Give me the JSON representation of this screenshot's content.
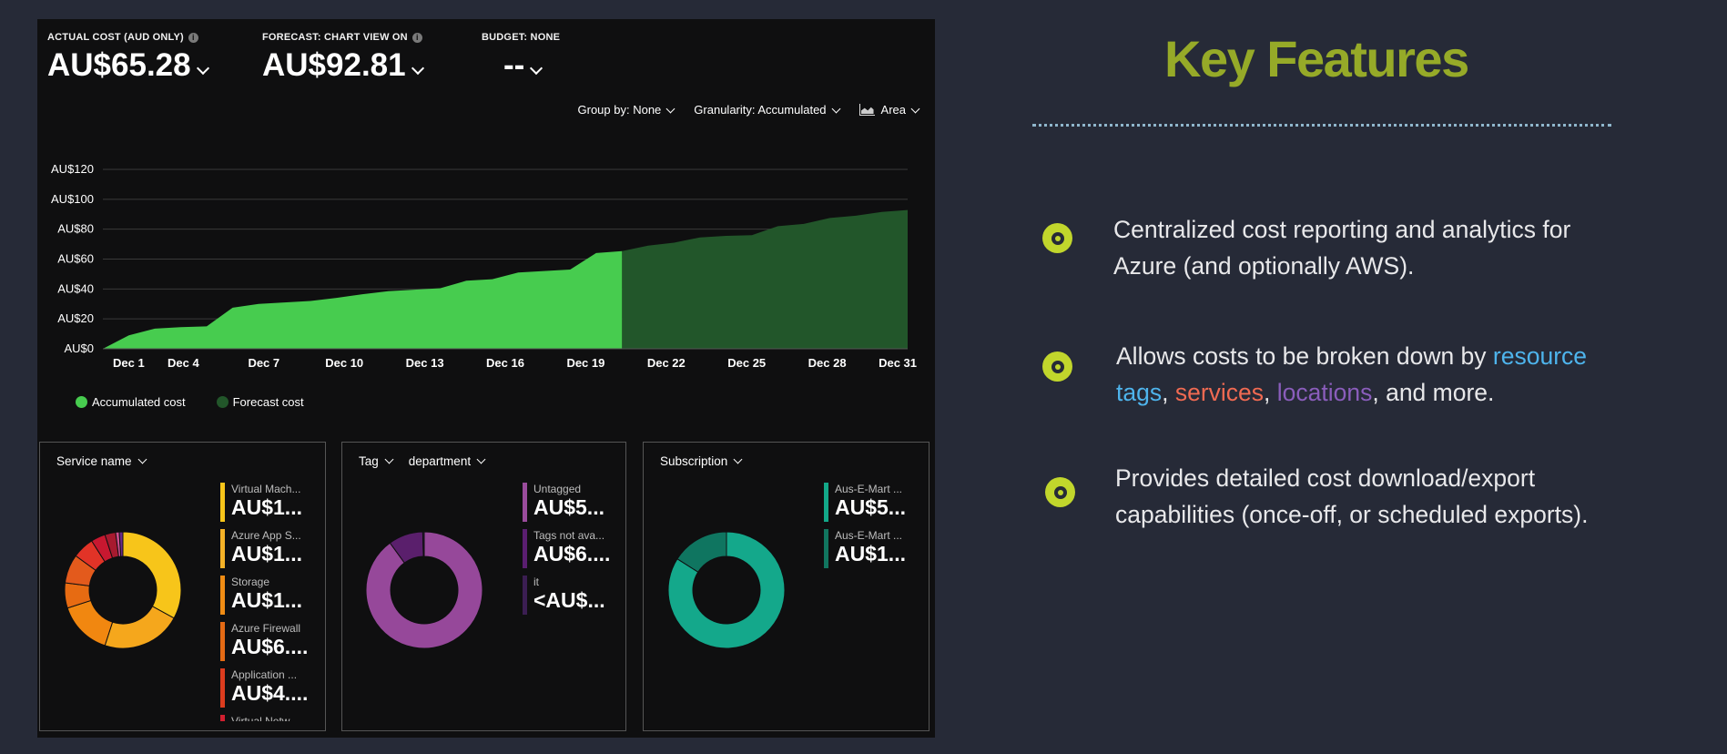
{
  "summary": {
    "actual": {
      "label": "ACTUAL COST (AUD ONLY)",
      "value": "AU$65.28"
    },
    "forecast": {
      "label": "FORECAST: CHART VIEW ON",
      "value": "AU$92.81"
    },
    "budget": {
      "label": "BUDGET: NONE",
      "value": "--"
    }
  },
  "controls": {
    "group_by": "Group by: None",
    "granularity": "Granularity: Accumulated",
    "view": "Area"
  },
  "chart_data": {
    "type": "area",
    "x_tick_labels": [
      "Dec 1",
      "Dec 4",
      "Dec 7",
      "Dec 10",
      "Dec 13",
      "Dec 16",
      "Dec 19",
      "Dec 22",
      "Dec 25",
      "Dec 28",
      "Dec 31"
    ],
    "y_tick_labels": [
      "AU$0",
      "AU$20",
      "AU$40",
      "AU$60",
      "AU$80",
      "AU$100",
      "AU$120"
    ],
    "ylim": [
      0,
      120
    ],
    "xlim": [
      0,
      31
    ],
    "grid": true,
    "legend_position": "bottom-left",
    "series": [
      {
        "name": "Accumulated cost",
        "color": "#47cc4f",
        "x": [
          0,
          1,
          2,
          3,
          4,
          5,
          6,
          7,
          8,
          9,
          10,
          11,
          12,
          13,
          14,
          15,
          16,
          17,
          18,
          19,
          20
        ],
        "values": [
          0,
          9,
          13.5,
          14.5,
          15,
          27.5,
          30,
          31,
          32,
          34,
          36.5,
          38.5,
          39.5,
          40.5,
          45.5,
          46.5,
          51,
          52,
          53,
          64,
          65.3
        ]
      },
      {
        "name": "Forecast cost",
        "color": "#22562a",
        "x": [
          20,
          21,
          22,
          23,
          24,
          25,
          26,
          27,
          28,
          29,
          30,
          31
        ],
        "values": [
          65.3,
          69,
          71,
          74.5,
          75.5,
          76,
          82,
          83.5,
          87.5,
          89,
          91.5,
          92.8
        ]
      }
    ]
  },
  "cards": [
    {
      "header": "Service name",
      "header2": "",
      "items": [
        {
          "name": "Virtual Mach...",
          "value": "AU$1...",
          "color": "#f7c51a"
        },
        {
          "name": "Azure App S...",
          "value": "AU$1...",
          "color": "#f5b227"
        },
        {
          "name": "Storage",
          "value": "AU$1...",
          "color": "#f08c14"
        },
        {
          "name": "Azure Firewall",
          "value": "AU$6....",
          "color": "#e46a14"
        },
        {
          "name": "Application ...",
          "value": "AU$4....",
          "color": "#dc3c1e"
        },
        {
          "name": "Virtual Netw...",
          "value": "",
          "color": "#d11f2f"
        }
      ],
      "donut": {
        "values": [
          33,
          22,
          15,
          7,
          8,
          6,
          4,
          3,
          1,
          1
        ],
        "colors": [
          "#f7c51a",
          "#f5a71c",
          "#f18710",
          "#e76b12",
          "#e35a1c",
          "#e23327",
          "#c81830",
          "#a71a2f",
          "#d04f8f",
          "#6b2a8a"
        ]
      }
    },
    {
      "header": "Tag",
      "header2": "department",
      "items": [
        {
          "name": "Untagged",
          "value": "AU$5...",
          "color": "#9a4c9c"
        },
        {
          "name": "Tags not ava...",
          "value": "AU$6....",
          "color": "#5a1e70"
        },
        {
          "name": "it",
          "value": "<AU$...",
          "color": "#3b1e52"
        }
      ],
      "donut": {
        "values": [
          90,
          9.6,
          0.4
        ],
        "colors": [
          "#96489a",
          "#5a1f6c",
          "#2f1a44"
        ]
      }
    },
    {
      "header": "Subscription",
      "header2": "",
      "items": [
        {
          "name": "Aus-E-Mart ...",
          "value": "AU$5...",
          "color": "#13a889"
        },
        {
          "name": "Aus-E-Mart ...",
          "value": "AU$1...",
          "color": "#11755f"
        }
      ],
      "donut": {
        "values": [
          84,
          16
        ],
        "colors": [
          "#14a88b",
          "#0f7560"
        ]
      }
    }
  ],
  "features": {
    "title": "Key Features",
    "items": [
      {
        "line1": "Centralized cost reporting and analytics for",
        "line2": "Azure (and optionally AWS)."
      },
      {
        "pre": "Allows costs to be broken down by ",
        "tags_a": "resource",
        "tags_b": "tags",
        "sep1": ", ",
        "services": "services",
        "sep2": ", ",
        "locations": "locations",
        "post": ", and more."
      },
      {
        "line1": "Provides detailed cost download/export",
        "line2": "capabilities (once-off, or scheduled exports)."
      }
    ]
  }
}
